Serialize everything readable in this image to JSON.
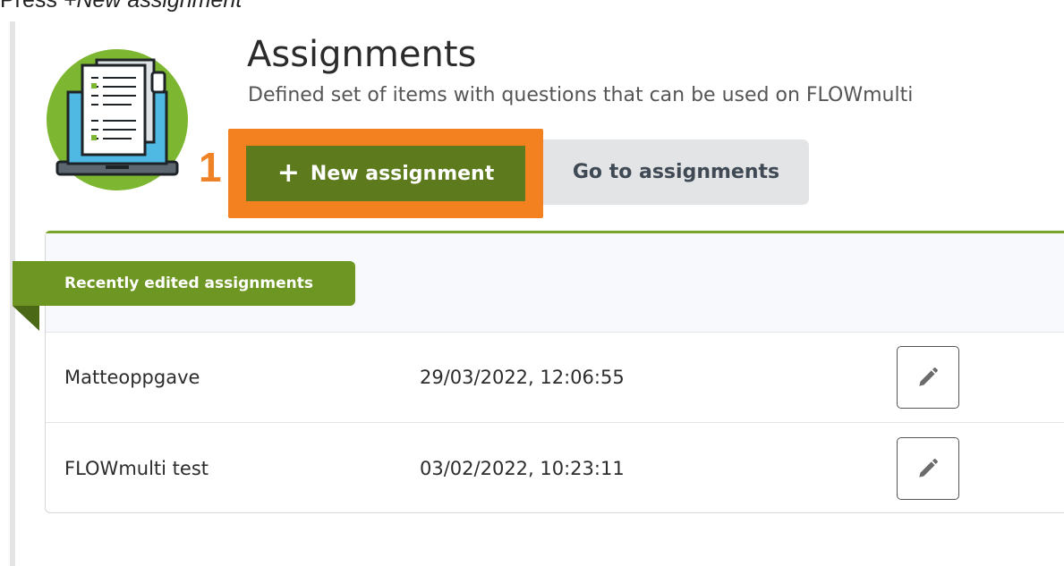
{
  "instruction": {
    "prefix": "Press ",
    "emphasis": "+New assignment"
  },
  "header": {
    "title": "Assignments",
    "subtitle": "Defined set of items with questions that can be used on FLOWmulti"
  },
  "actions": {
    "step_number": "1",
    "new_assignment_icon": "+",
    "new_assignment_label": "New assignment",
    "go_to_assignments_label": "Go to assignments"
  },
  "recent": {
    "tab_label": "Recently edited assignments",
    "rows": [
      {
        "name": "Matteoppgave",
        "edited": "29/03/2022, 12:06:55",
        "action_icon": "pencil-icon"
      },
      {
        "name": "FLOWmulti test",
        "edited": "03/02/2022, 10:23:11",
        "action_icon": "pencil-icon"
      }
    ]
  },
  "colors": {
    "primary_green": "#5d7b1c",
    "ribbon_green": "#6e9622",
    "highlight_orange": "#f48120",
    "logo_green": "#7db630",
    "logo_blue": "#4fb8e3"
  }
}
